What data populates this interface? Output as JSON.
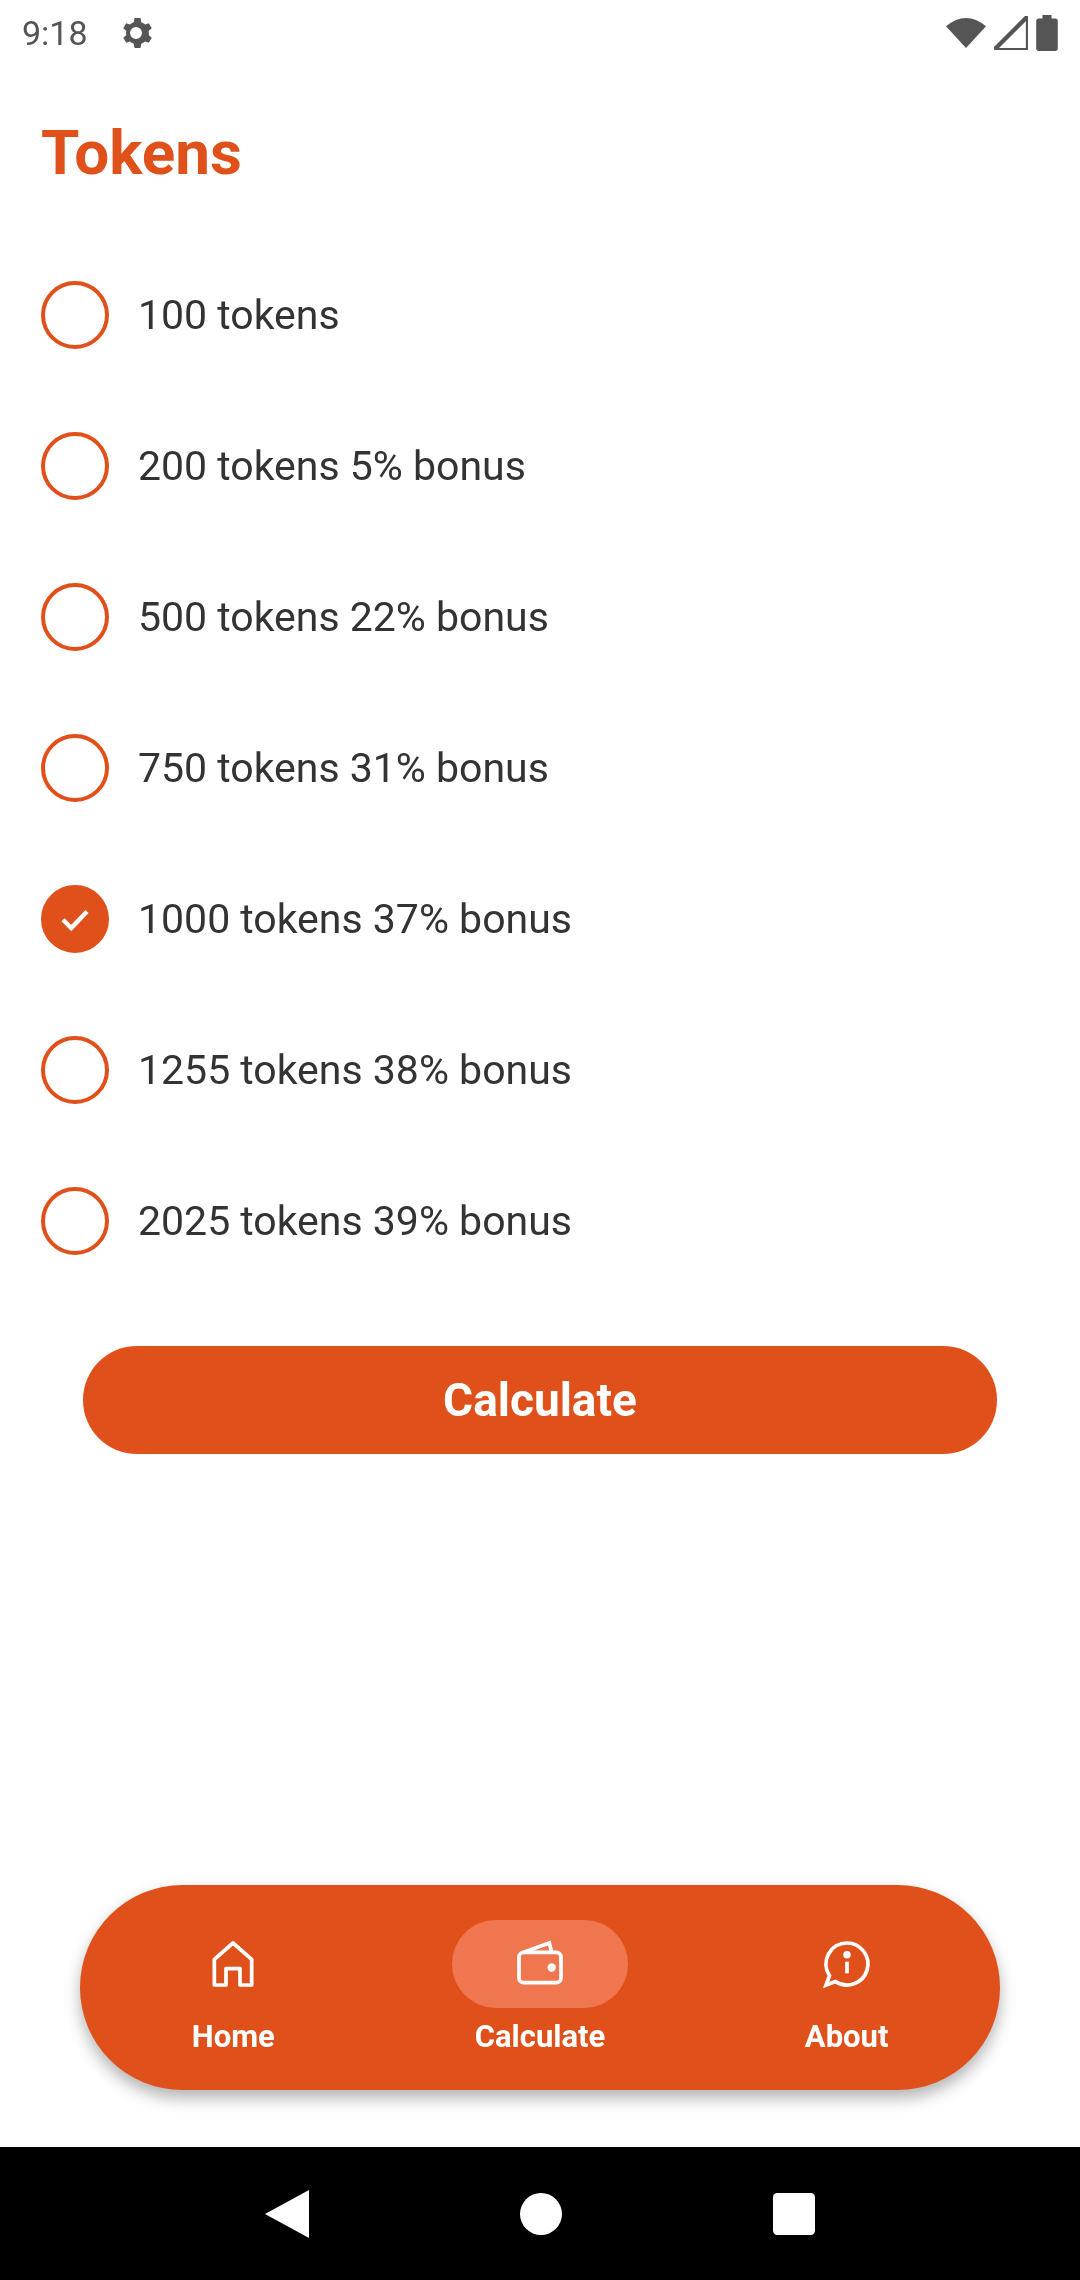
{
  "status_bar": {
    "time": "9:18"
  },
  "title": "Tokens",
  "options": [
    {
      "label": "100 tokens",
      "selected": false
    },
    {
      "label": "200 tokens 5% bonus",
      "selected": false
    },
    {
      "label": "500 tokens 22% bonus",
      "selected": false
    },
    {
      "label": "750 tokens 31% bonus",
      "selected": false
    },
    {
      "label": "1000 tokens 37% bonus",
      "selected": true
    },
    {
      "label": "1255 tokens 38% bonus",
      "selected": false
    },
    {
      "label": "2025 tokens 39% bonus",
      "selected": false
    }
  ],
  "button": "Calculate",
  "nav": [
    {
      "label": "Home",
      "selected": false
    },
    {
      "label": "Calculate",
      "selected": true
    },
    {
      "label": "About",
      "selected": false
    }
  ]
}
